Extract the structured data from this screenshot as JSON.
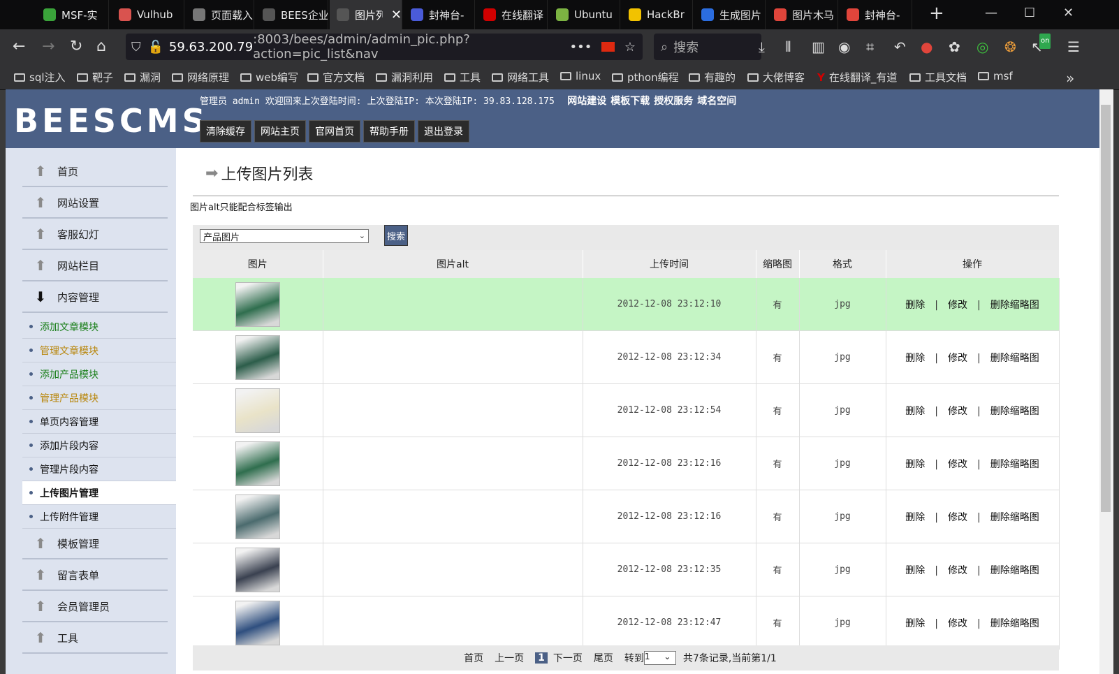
{
  "browser": {
    "tabs": [
      {
        "label": "MSF-实",
        "icon": "msf-icon",
        "color": "#3aa33a"
      },
      {
        "label": "Vulhub",
        "icon": "vulhub-icon",
        "color": "#d9534f"
      },
      {
        "label": "页面载入",
        "icon": "warning-icon",
        "color": "#777777"
      },
      {
        "label": "BEES企业网",
        "icon": "page-icon",
        "color": "#555555"
      },
      {
        "label": "图片列表",
        "icon": "page-icon",
        "color": "#555555"
      },
      {
        "label": "封神台-",
        "icon": "shield-icon",
        "color": "#4a5bd9"
      },
      {
        "label": "在线翻译",
        "icon": "youdao-icon",
        "color": "#d00000"
      },
      {
        "label": "Ubuntu",
        "icon": "ubuntu-icon",
        "color": "#7cb342"
      },
      {
        "label": "HackBr",
        "icon": "hackbar-icon",
        "color": "#f2c200"
      },
      {
        "label": "生成图片",
        "icon": "baidu-icon",
        "color": "#2b6de0"
      },
      {
        "label": "图片木马",
        "icon": "csdn-icon",
        "color": "#e0453b"
      },
      {
        "label": "封神台-",
        "icon": "csdn-icon",
        "color": "#e0453b"
      }
    ],
    "url_host": "59.63.200.79",
    "url_path": ":8003/bees/admin/admin_pic.php?action=pic_list&nav",
    "search_placeholder": "搜索",
    "bookmarks": [
      "sql注入",
      "靶子",
      "漏洞",
      "网络原理",
      "web编写",
      "官方文档",
      "漏洞利用",
      "工具",
      "网络工具",
      "linux",
      "pthon编程",
      "有趣的",
      "大佬博客",
      "在线翻译_有道",
      "工具文档",
      "msf"
    ],
    "ext_badge": "on"
  },
  "header": {
    "logo": "BEESCMS",
    "admin_info": "管理员 admin 欢迎回来上次登陆时间: 上次登陆IP: 本次登陆IP: 39.83.128.175",
    "links": [
      "网站建设",
      "模板下载",
      "授权服务",
      "域名空间"
    ],
    "buttons": [
      "清除缓存",
      "网站主页",
      "官网首页",
      "帮助手册",
      "退出登录"
    ]
  },
  "sidebar": {
    "top_items": [
      "首页",
      "网站设置",
      "客服幻灯",
      "网站栏目",
      "内容管理"
    ],
    "sub_items": [
      {
        "label": "添加文章模块",
        "color": "#1a7f1a"
      },
      {
        "label": "管理文章模块",
        "color": "#b8860b"
      },
      {
        "label": "添加产品模块",
        "color": "#1a7f1a"
      },
      {
        "label": "管理产品模块",
        "color": "#b8860b"
      },
      {
        "label": "单页内容管理",
        "color": "#111111"
      },
      {
        "label": "添加片段内容",
        "color": "#111111"
      },
      {
        "label": "管理片段内容",
        "color": "#111111"
      },
      {
        "label": "上传图片管理",
        "color": "#111111"
      },
      {
        "label": "上传附件管理",
        "color": "#111111"
      }
    ],
    "bottom_items": [
      "模板管理",
      "留言表单",
      "会员管理员",
      "工具"
    ]
  },
  "main": {
    "title": "上传图片列表",
    "note": "图片alt只能配合标签输出",
    "category_select": "产品图片",
    "search_button": "搜索",
    "columns": [
      "图片",
      "图片alt",
      "上传时间",
      "缩略图",
      "格式",
      "操作"
    ],
    "rows": [
      {
        "alt": "",
        "time": "2012-12-08 23:12:10",
        "thumb": "有",
        "format": "jpg"
      },
      {
        "alt": "",
        "time": "2012-12-08 23:12:34",
        "thumb": "有",
        "format": "jpg"
      },
      {
        "alt": "",
        "time": "2012-12-08 23:12:54",
        "thumb": "有",
        "format": "jpg"
      },
      {
        "alt": "",
        "time": "2012-12-08 23:12:16",
        "thumb": "有",
        "format": "jpg"
      },
      {
        "alt": "",
        "time": "2012-12-08 23:12:16",
        "thumb": "有",
        "format": "jpg"
      },
      {
        "alt": "",
        "time": "2012-12-08 23:12:35",
        "thumb": "有",
        "format": "jpg"
      },
      {
        "alt": "",
        "time": "2012-12-08 23:12:47",
        "thumb": "有",
        "format": "jpg"
      }
    ],
    "ops": {
      "delete": "删除",
      "edit": "修改",
      "delete_thumb": "删除缩略图"
    },
    "pager": {
      "first": "首页",
      "prev": "上一页",
      "current": "1",
      "next": "下一页",
      "last": "尾页",
      "goto": "转到",
      "goto_value": "1",
      "summary": "共7条记录,当前第1/1"
    }
  }
}
